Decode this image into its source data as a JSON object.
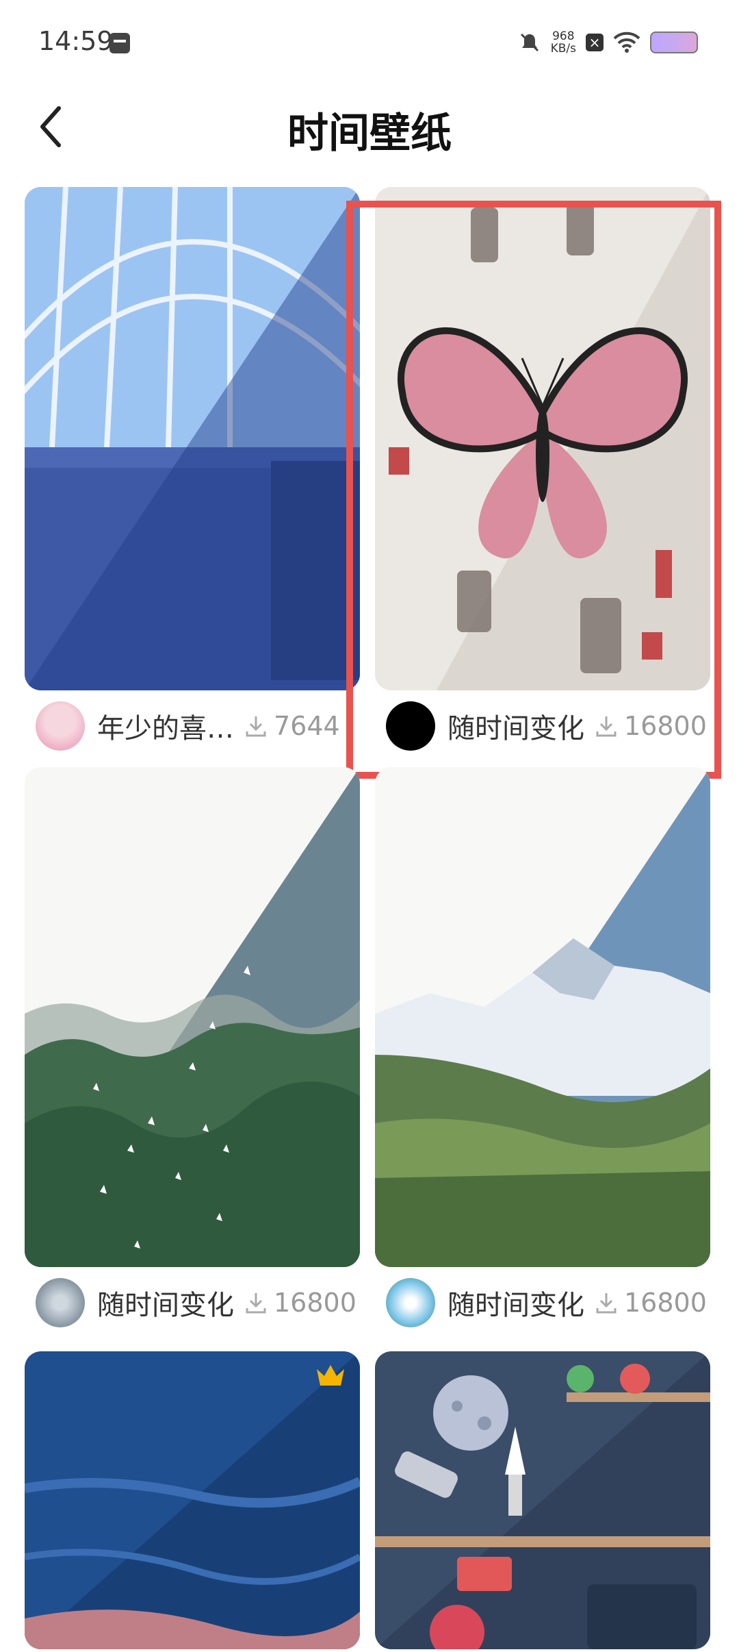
{
  "status_bar": {
    "time": "14:59",
    "net_speed_value": "968",
    "net_speed_unit": "KB/s"
  },
  "header": {
    "title": "时间壁纸"
  },
  "wallpapers": [
    {
      "author": "年少的喜…",
      "downloads": "7644"
    },
    {
      "author": "随时间变化",
      "downloads": "16800"
    },
    {
      "author": "随时间变化",
      "downloads": "16800"
    },
    {
      "author": "随时间变化",
      "downloads": "16800"
    },
    {
      "author": "",
      "downloads": "",
      "vip": true
    },
    {
      "author": "",
      "downloads": ""
    }
  ],
  "colors": {
    "highlight": "#e8524f",
    "text_secondary": "#999999"
  }
}
